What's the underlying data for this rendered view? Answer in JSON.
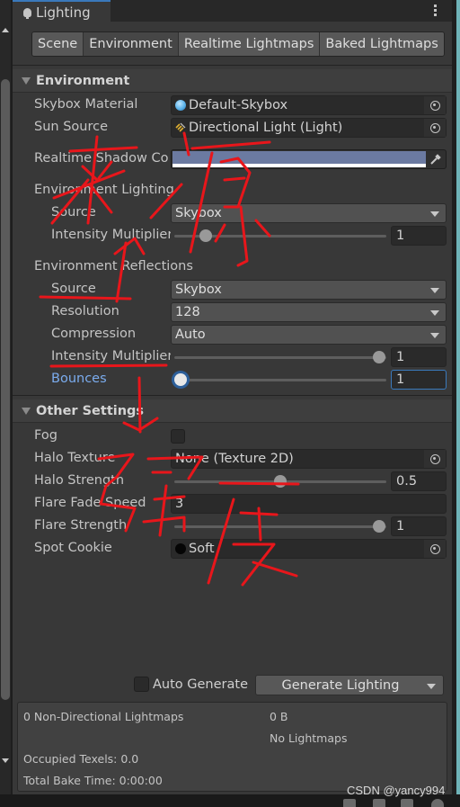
{
  "window": {
    "tab_title": "Lighting",
    "menu_icon": "kebab-menu-icon"
  },
  "toolbar": {
    "tabs": [
      {
        "label": "Scene",
        "active": false
      },
      {
        "label": "Environment",
        "active": true
      },
      {
        "label": "Realtime Lightmaps",
        "active": false
      },
      {
        "label": "Baked Lightmaps",
        "active": false
      }
    ]
  },
  "environment": {
    "header": "Environment",
    "skybox_material": {
      "label": "Skybox Material",
      "value": "Default-Skybox"
    },
    "sun_source": {
      "label": "Sun Source",
      "value": "Directional Light (Light)"
    },
    "realtime_shadow_color": {
      "label": "Realtime Shadow Co",
      "color": "#6b7aa1"
    },
    "environment_lighting": {
      "label": "Environment Lighting",
      "source": {
        "label": "Source",
        "value": "Skybox"
      },
      "intensity": {
        "label": "Intensity Multiplier",
        "value": "1",
        "slider_fraction": 0.125
      }
    },
    "environment_reflections": {
      "label": "Environment Reflections",
      "source": {
        "label": "Source",
        "value": "Skybox"
      },
      "resolution": {
        "label": "Resolution",
        "value": "128"
      },
      "compression": {
        "label": "Compression",
        "value": "Auto"
      },
      "intensity": {
        "label": "Intensity Multiplier",
        "value": "1",
        "slider_fraction": 1.0
      },
      "bounces": {
        "label": "Bounces",
        "value": "1",
        "slider_fraction": 0.0
      }
    }
  },
  "other_settings": {
    "header": "Other Settings",
    "fog": {
      "label": "Fog",
      "checked": false
    },
    "halo_texture": {
      "label": "Halo Texture",
      "value": "None (Texture 2D)"
    },
    "halo_strength": {
      "label": "Halo Strength",
      "value": "0.5",
      "slider_fraction": 0.5
    },
    "flare_fade_speed": {
      "label": "Flare Fade Speed",
      "value": "3"
    },
    "flare_strength": {
      "label": "Flare Strength",
      "value": "1",
      "slider_fraction": 1.0
    },
    "spot_cookie": {
      "label": "Spot Cookie",
      "value": "Soft"
    }
  },
  "footer": {
    "auto_generate_label": "Auto Generate",
    "auto_generate_checked": false,
    "generate_button": "Generate Lighting",
    "stats": {
      "lightmaps": "0 Non-Directional Lightmaps",
      "size": "0 B",
      "no_lightmaps": "No Lightmaps",
      "occupied_texels": "Occupied Texels: 0.0",
      "bake_time": "Total Bake Time: 0:00:00"
    }
  },
  "watermark": "CSDN @yancy994",
  "annotations": {
    "color": "#e8161b",
    "handwritten_1": "来源",
    "handwritten_2": "强度"
  },
  "colors": {
    "accent": "#3a79bb",
    "panel": "#383838",
    "label_highlight": "#7bacee"
  }
}
